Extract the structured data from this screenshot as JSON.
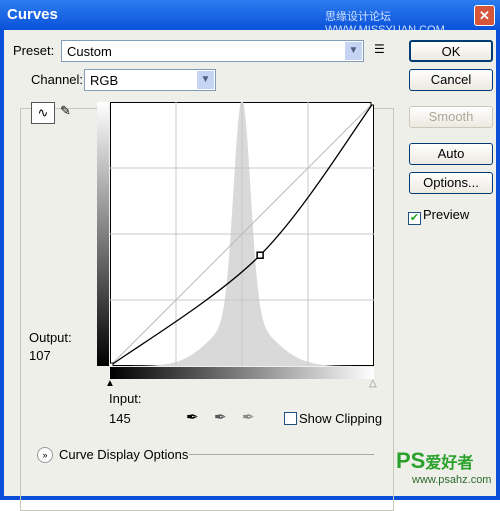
{
  "window": {
    "title": "Curves",
    "watermark": "思缘设计论坛 WWW.MISSYUAN.COM",
    "close_icon": "close-icon"
  },
  "preset": {
    "label": "Preset:",
    "value": "Custom"
  },
  "channel": {
    "label": "Channel:",
    "value": "RGB"
  },
  "buttons": {
    "ok": "OK",
    "cancel": "Cancel",
    "smooth": "Smooth",
    "auto": "Auto",
    "options": "Options..."
  },
  "preview": {
    "label": "Preview",
    "checked": true
  },
  "output": {
    "label": "Output:",
    "value": "107"
  },
  "input": {
    "label": "Input:",
    "value": "145"
  },
  "show_clipping": {
    "label": "Show Clipping",
    "checked": false
  },
  "curve_display_options": "Curve Display Options",
  "curve": {
    "points": [
      [
        0,
        0
      ],
      [
        145,
        107
      ],
      [
        255,
        255
      ]
    ],
    "selected_point": [
      145,
      107
    ],
    "range": [
      0,
      255
    ],
    "grid": "4x4"
  },
  "logo": {
    "text": "PS爱好者",
    "url_text": "www.psahz.com"
  }
}
